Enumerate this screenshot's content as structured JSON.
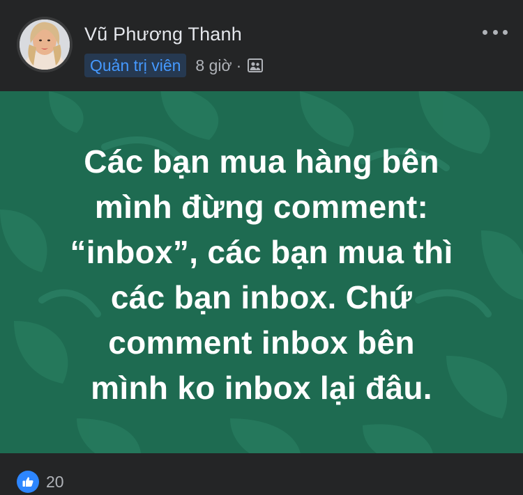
{
  "post": {
    "author_name": "Vũ Phương Thanh",
    "role_badge": "Quản trị viên",
    "timestamp": "8 giờ",
    "separator": "·",
    "audience_icon": "group-icon",
    "more_icon": "more-options-icon",
    "card_lines": [
      "Các bạn mua hàng bên",
      "mình đừng comment:",
      "“inbox”, các bạn mua thì",
      "các bạn inbox. Chứ",
      "comment inbox bên",
      "mình ko inbox lại đâu."
    ],
    "card_background_color": "#1e6b51",
    "reaction_icon": "like-icon",
    "reaction_count": "20"
  },
  "colors": {
    "badge_text": "#4599ff",
    "badge_bg": "#263951",
    "like_blue": "#2d86ff"
  }
}
